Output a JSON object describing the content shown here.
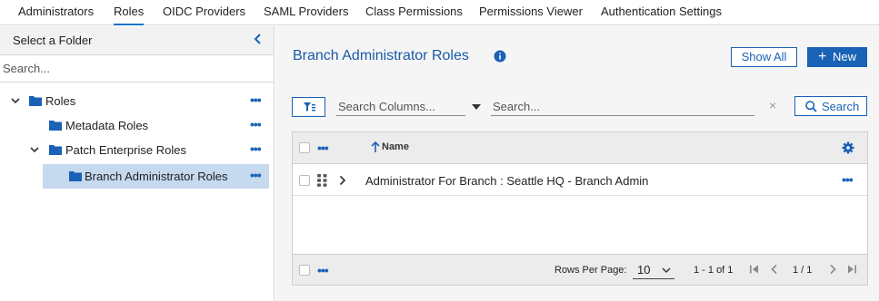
{
  "tabs": [
    {
      "label": "Administrators",
      "active": false
    },
    {
      "label": "Roles",
      "active": true
    },
    {
      "label": "OIDC Providers",
      "active": false
    },
    {
      "label": "SAML Providers",
      "active": false
    },
    {
      "label": "Class Permissions",
      "active": false
    },
    {
      "label": "Permissions Viewer",
      "active": false
    },
    {
      "label": "Authentication Settings",
      "active": false
    }
  ],
  "sidebar": {
    "title": "Select a Folder",
    "search_placeholder": "Search...",
    "tree": [
      {
        "label": "Roles",
        "expanded": true,
        "selected": false
      },
      {
        "label": "Metadata Roles",
        "expanded": false,
        "selected": false
      },
      {
        "label": "Patch Enterprise Roles",
        "expanded": true,
        "selected": false
      },
      {
        "label": "Branch Administrator Roles",
        "expanded": false,
        "selected": true
      }
    ],
    "more_label": "•••"
  },
  "main": {
    "title": "Branch Administrator Roles",
    "show_all_label": "Show All",
    "new_label": "New",
    "new_icon": "+",
    "column_search_placeholder": "Search Columns...",
    "search_placeholder": "Search...",
    "clear_icon": "×",
    "search_button_label": "Search"
  },
  "grid": {
    "more_label": "•••",
    "column_header": "Name",
    "sort": "ascending",
    "rows": [
      {
        "name": "Administrator For Branch : Seattle HQ - Branch Admin"
      }
    ],
    "footer": {
      "rows_per_page_label": "Rows Per Page:",
      "rows_per_page": "10",
      "range": "1 - 1 of 1",
      "pages": "1 / 1"
    }
  },
  "colors": {
    "accent": "#1a62b5",
    "title": "#1a5aa6",
    "selected_row": "#c5d9ef",
    "panel_bg": "#f5f5f5"
  },
  "icons": [
    "chevron-left-icon",
    "chevron-down-icon",
    "chevron-right-icon",
    "folder-icon",
    "info-icon",
    "plus-icon",
    "filter-icon",
    "search-icon",
    "sort-up-icon",
    "gear-icon",
    "drag-handle-icon",
    "first-page-icon",
    "prev-page-icon",
    "next-page-icon",
    "last-page-icon"
  ]
}
